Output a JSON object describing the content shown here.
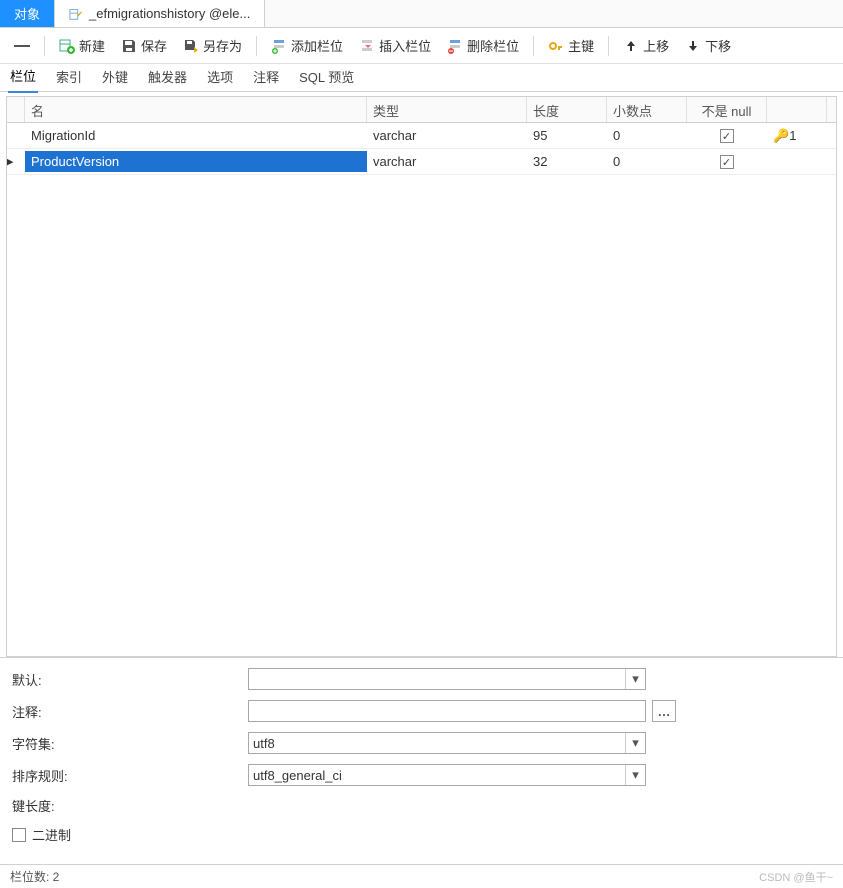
{
  "topTabs": {
    "objects": "对象",
    "editor": "_efmigrationshistory @ele..."
  },
  "toolbar": {
    "new": "新建",
    "save": "保存",
    "saveAs": "另存为",
    "addField": "添加栏位",
    "insertField": "插入栏位",
    "deleteField": "删除栏位",
    "primaryKey": "主键",
    "moveUp": "上移",
    "moveDown": "下移"
  },
  "subTabs": {
    "fields": "栏位",
    "indexes": "索引",
    "foreignKeys": "外键",
    "triggers": "触发器",
    "options": "选项",
    "comment": "注释",
    "sqlPreview": "SQL 预览"
  },
  "gridHeaders": {
    "name": "名",
    "type": "类型",
    "length": "长度",
    "decimals": "小数点",
    "notNull": "不是 null"
  },
  "rows": [
    {
      "name": "MigrationId",
      "type": "varchar",
      "length": "95",
      "decimals": "0",
      "notNull": true,
      "pk": "1",
      "selected": false
    },
    {
      "name": "ProductVersion",
      "type": "varchar",
      "length": "32",
      "decimals": "0",
      "notNull": true,
      "pk": "",
      "selected": true
    }
  ],
  "props": {
    "defaultLabel": "默认:",
    "defaultValue": "",
    "commentLabel": "注释:",
    "commentValue": "",
    "charsetLabel": "字符集:",
    "charsetValue": "utf8",
    "collationLabel": "排序规则:",
    "collationValue": "utf8_general_ci",
    "keyLengthLabel": "键长度:",
    "keyLengthValue": "",
    "binaryLabel": "二进制"
  },
  "status": {
    "fieldCount": "栏位数: 2"
  },
  "watermark": "CSDN @鱼干~"
}
